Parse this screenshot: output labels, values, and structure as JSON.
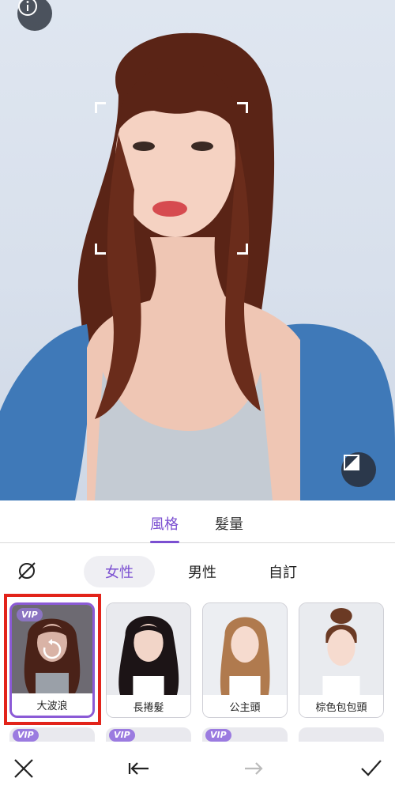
{
  "preview": {
    "info_icon": "info-icon",
    "compare_icon": "compare-icon"
  },
  "tabs": [
    {
      "label": "風格",
      "active": true
    },
    {
      "label": "髮量",
      "active": false
    }
  ],
  "gender": {
    "none_icon": "no-style-icon",
    "options": [
      {
        "label": "女性",
        "active": true
      },
      {
        "label": "男性",
        "active": false
      },
      {
        "label": "自訂",
        "active": false
      }
    ]
  },
  "styles": [
    {
      "label": "大波浪",
      "vip": "VIP",
      "selected": true
    },
    {
      "label": "長捲髮",
      "vip": "",
      "selected": false
    },
    {
      "label": "公主頭",
      "vip": "",
      "selected": false
    },
    {
      "label": "棕色包包頭",
      "vip": "",
      "selected": false
    }
  ],
  "styles_row2": [
    {
      "vip": "VIP"
    },
    {
      "vip": "VIP"
    },
    {
      "vip": "VIP"
    },
    {
      "vip": ""
    }
  ],
  "toolbar": {
    "close_icon": "close-icon",
    "undo_icon": "undo-icon",
    "redo_icon": "redo-icon",
    "confirm_icon": "check-icon"
  },
  "colors": {
    "accent": "#7b4fd1",
    "highlight_frame": "#e2231a",
    "hair": "#5a2416",
    "denim": "#3f79b8"
  }
}
